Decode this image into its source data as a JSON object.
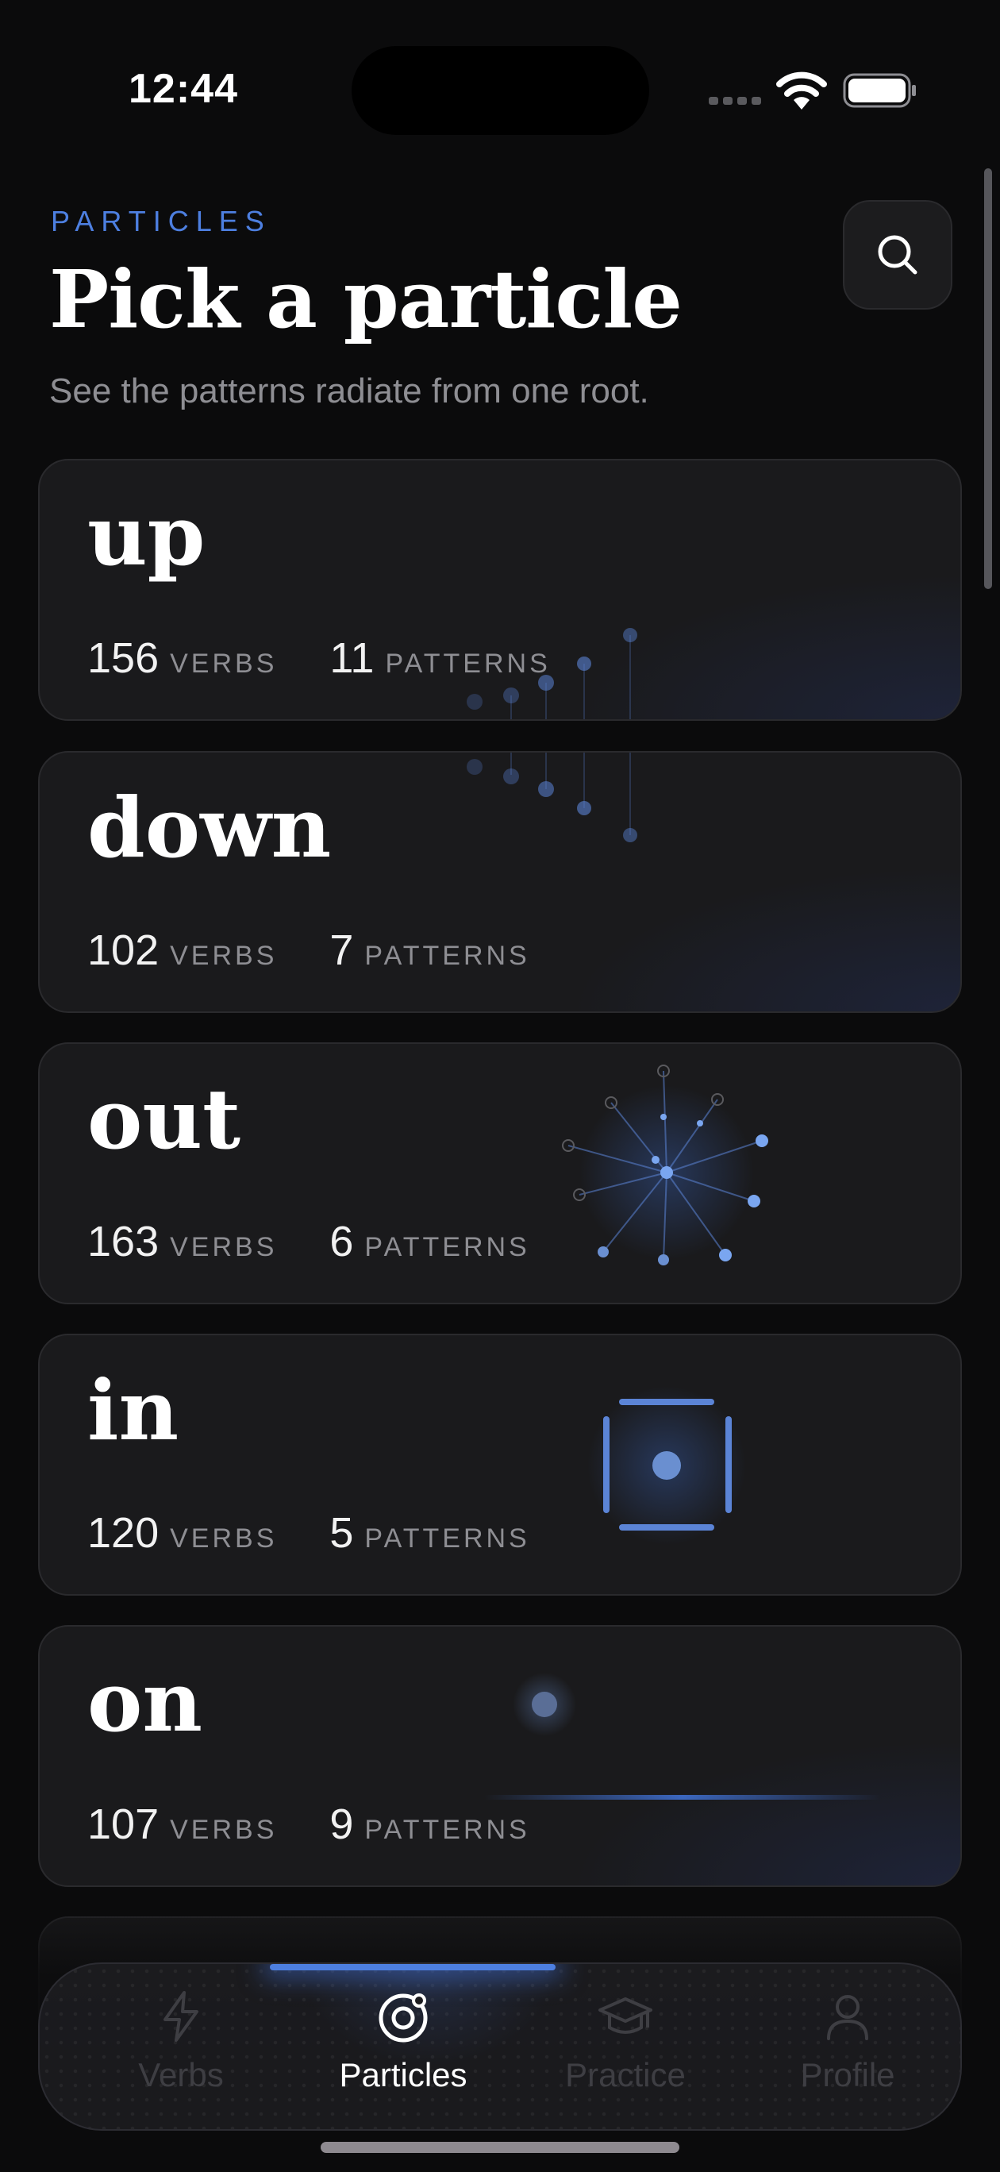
{
  "status_bar": {
    "time": "12:44"
  },
  "header": {
    "eyebrow": "PARTICLES",
    "title": "Pick a particle",
    "subtitle": "See the patterns radiate from one root."
  },
  "particles": [
    {
      "name": "up",
      "verbs": "156",
      "verbs_label": "VERBS",
      "patterns": "11",
      "patterns_label": "PATTERNS",
      "art": "rising-dots"
    },
    {
      "name": "down",
      "verbs": "102",
      "verbs_label": "VERBS",
      "patterns": "7",
      "patterns_label": "PATTERNS",
      "art": "falling-dots"
    },
    {
      "name": "out",
      "verbs": "163",
      "verbs_label": "VERBS",
      "patterns": "6",
      "patterns_label": "PATTERNS",
      "art": "radiating-burst"
    },
    {
      "name": "in",
      "verbs": "120",
      "verbs_label": "VERBS",
      "patterns": "5",
      "patterns_label": "PATTERNS",
      "art": "enclosed-dot"
    },
    {
      "name": "on",
      "verbs": "107",
      "verbs_label": "VERBS",
      "patterns": "9",
      "patterns_label": "PATTERNS",
      "art": "dot-on-line"
    }
  ],
  "tabbar": {
    "tabs": [
      {
        "label": "Verbs",
        "icon": "lightning-icon",
        "active": false
      },
      {
        "label": "Particles",
        "icon": "orbit-icon",
        "active": true
      },
      {
        "label": "Practice",
        "icon": "graduation-cap-icon",
        "active": false
      },
      {
        "label": "Profile",
        "icon": "person-icon",
        "active": false
      }
    ]
  },
  "colors": {
    "accent": "#4d7fe0",
    "background": "#0b0b0c",
    "card": "#1a1a1c",
    "muted": "#8e8e93"
  }
}
